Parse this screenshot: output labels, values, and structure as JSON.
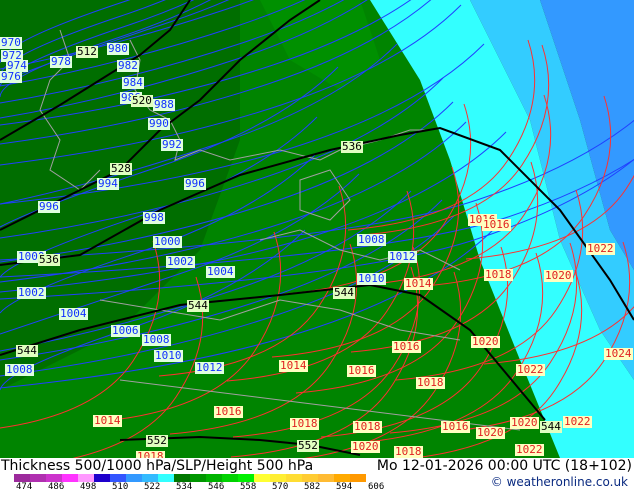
{
  "title": "Thickness 500/1000 hPa/SLP/Height 500 hPa",
  "datetime": "Mo 12-01-2026 00:00 UTC (18+102)",
  "credit": "© weatheronline.co.uk",
  "legend": {
    "colors": [
      "#9c2a9c",
      "#b030b0",
      "#cc33cc",
      "#ff33ff",
      "#ff99ff",
      "#1e00cc",
      "#3355ff",
      "#3399ff",
      "#33bbff",
      "#33ffff",
      "#007800",
      "#009600",
      "#00b400",
      "#00d200",
      "#00f000",
      "#ffff33",
      "#ffee33",
      "#ffdd33",
      "#ffcc33",
      "#ffbb33",
      "#ffaa00",
      "#ff9900"
    ],
    "ticks": [
      "474",
      "486",
      "498",
      "510",
      "522",
      "534",
      "546",
      "558",
      "570",
      "582",
      "594",
      "606"
    ]
  },
  "colors": {
    "thickness_dark": "#007000",
    "thickness_mid": "#008c00",
    "cyan": "#33ffff",
    "lightblue": "#33ccff",
    "blue": "#3399ff",
    "slp_low": "#1030ff",
    "slp_high": "#e02020",
    "height": "#000000"
  },
  "slp_labels_low": [
    "970",
    "972",
    "974",
    "976",
    "978",
    "980",
    "982",
    "984",
    "986",
    "988",
    "990",
    "992",
    "994",
    "996",
    "996",
    "998",
    "1000",
    "1002",
    "1000",
    "1002",
    "1004",
    "1004",
    "1006",
    "1008",
    "1010",
    "1008",
    "1012",
    "1008",
    "1012",
    "1010"
  ],
  "slp_labels_high": [
    "1014",
    "1016",
    "1016",
    "1018",
    "1020",
    "1022",
    "1020",
    "1016",
    "1014",
    "1016",
    "1018",
    "1022",
    "1024",
    "1016",
    "1014",
    "1018",
    "1018",
    "1016",
    "1020",
    "1020",
    "1022",
    "1020",
    "1018",
    "1022",
    "1018"
  ],
  "height_labels": [
    "512",
    "520",
    "528",
    "536",
    "536",
    "544",
    "544",
    "544",
    "552",
    "552",
    "544"
  ]
}
